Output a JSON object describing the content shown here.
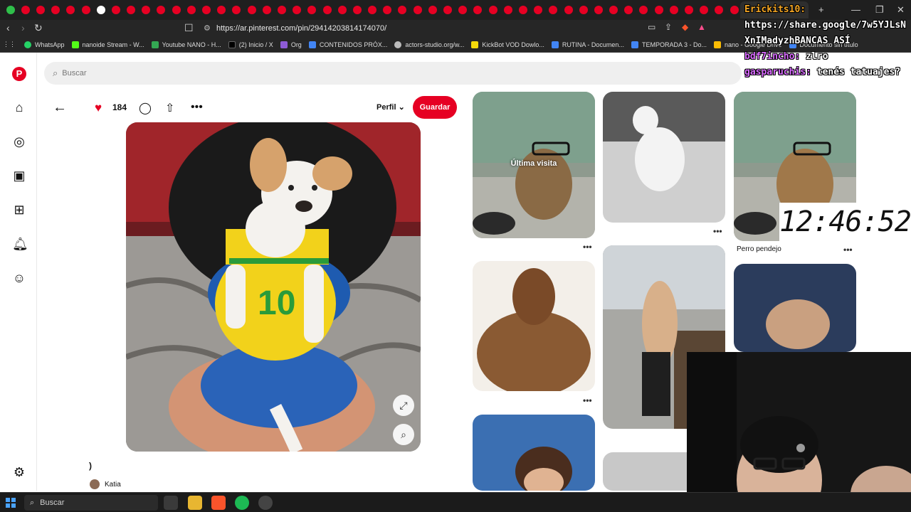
{
  "browser": {
    "url": "https://ar.pinterest.com/pin/29414203814174070/",
    "bookmarks": [
      {
        "label": "WhatsApp",
        "color": "#25d366"
      },
      {
        "label": "nanoide Stream - W...",
        "color": "#53fc18"
      },
      {
        "label": "Youtube NANO - H...",
        "color": "#34a853"
      },
      {
        "label": "(2) Inicio / X",
        "color": "#000000"
      },
      {
        "label": "Org",
        "color": "#8e5bd6"
      },
      {
        "label": "CONTENIDOS PRÓX...",
        "color": "#4285f4"
      },
      {
        "label": "actors-studio.org/w...",
        "color": "#bbbbbb"
      },
      {
        "label": "KickBot VOD Dowlo...",
        "color": "#f5d90a"
      },
      {
        "label": "RUTINA - Documen...",
        "color": "#4285f4"
      },
      {
        "label": "TEMPORADA 3 - Do...",
        "color": "#4285f4"
      },
      {
        "label": "nano - Google Drive",
        "color": "#fbbc04"
      },
      {
        "label": "Documento sin título",
        "color": "#4285f4"
      }
    ]
  },
  "search": {
    "placeholder": "Buscar"
  },
  "pin": {
    "likes": "184",
    "perfil_label": "Perfil",
    "save_label": "Guardar",
    "title": ")",
    "creator": "Katia"
  },
  "grid": {
    "last_visit_label": "Última visita",
    "pin_label_perro": "Perro pendejo",
    "dots": "..."
  },
  "overlay": {
    "chat": [
      {
        "name": "Erickits10:",
        "text": ""
      },
      {
        "name": "",
        "text": "https://share.google/7w5YJLsN"
      },
      {
        "name": "",
        "text": "XnIMadyzhBANCAS ASÍ"
      },
      {
        "name": "bdf7incho:",
        "text": " zlro"
      },
      {
        "name": "gasparuchis:",
        "text": " tenés tatuajes?"
      }
    ],
    "clock": "12:46:52"
  },
  "taskbar": {
    "search_label": "Buscar"
  },
  "colors": {
    "pinterest_red": "#e60023"
  }
}
